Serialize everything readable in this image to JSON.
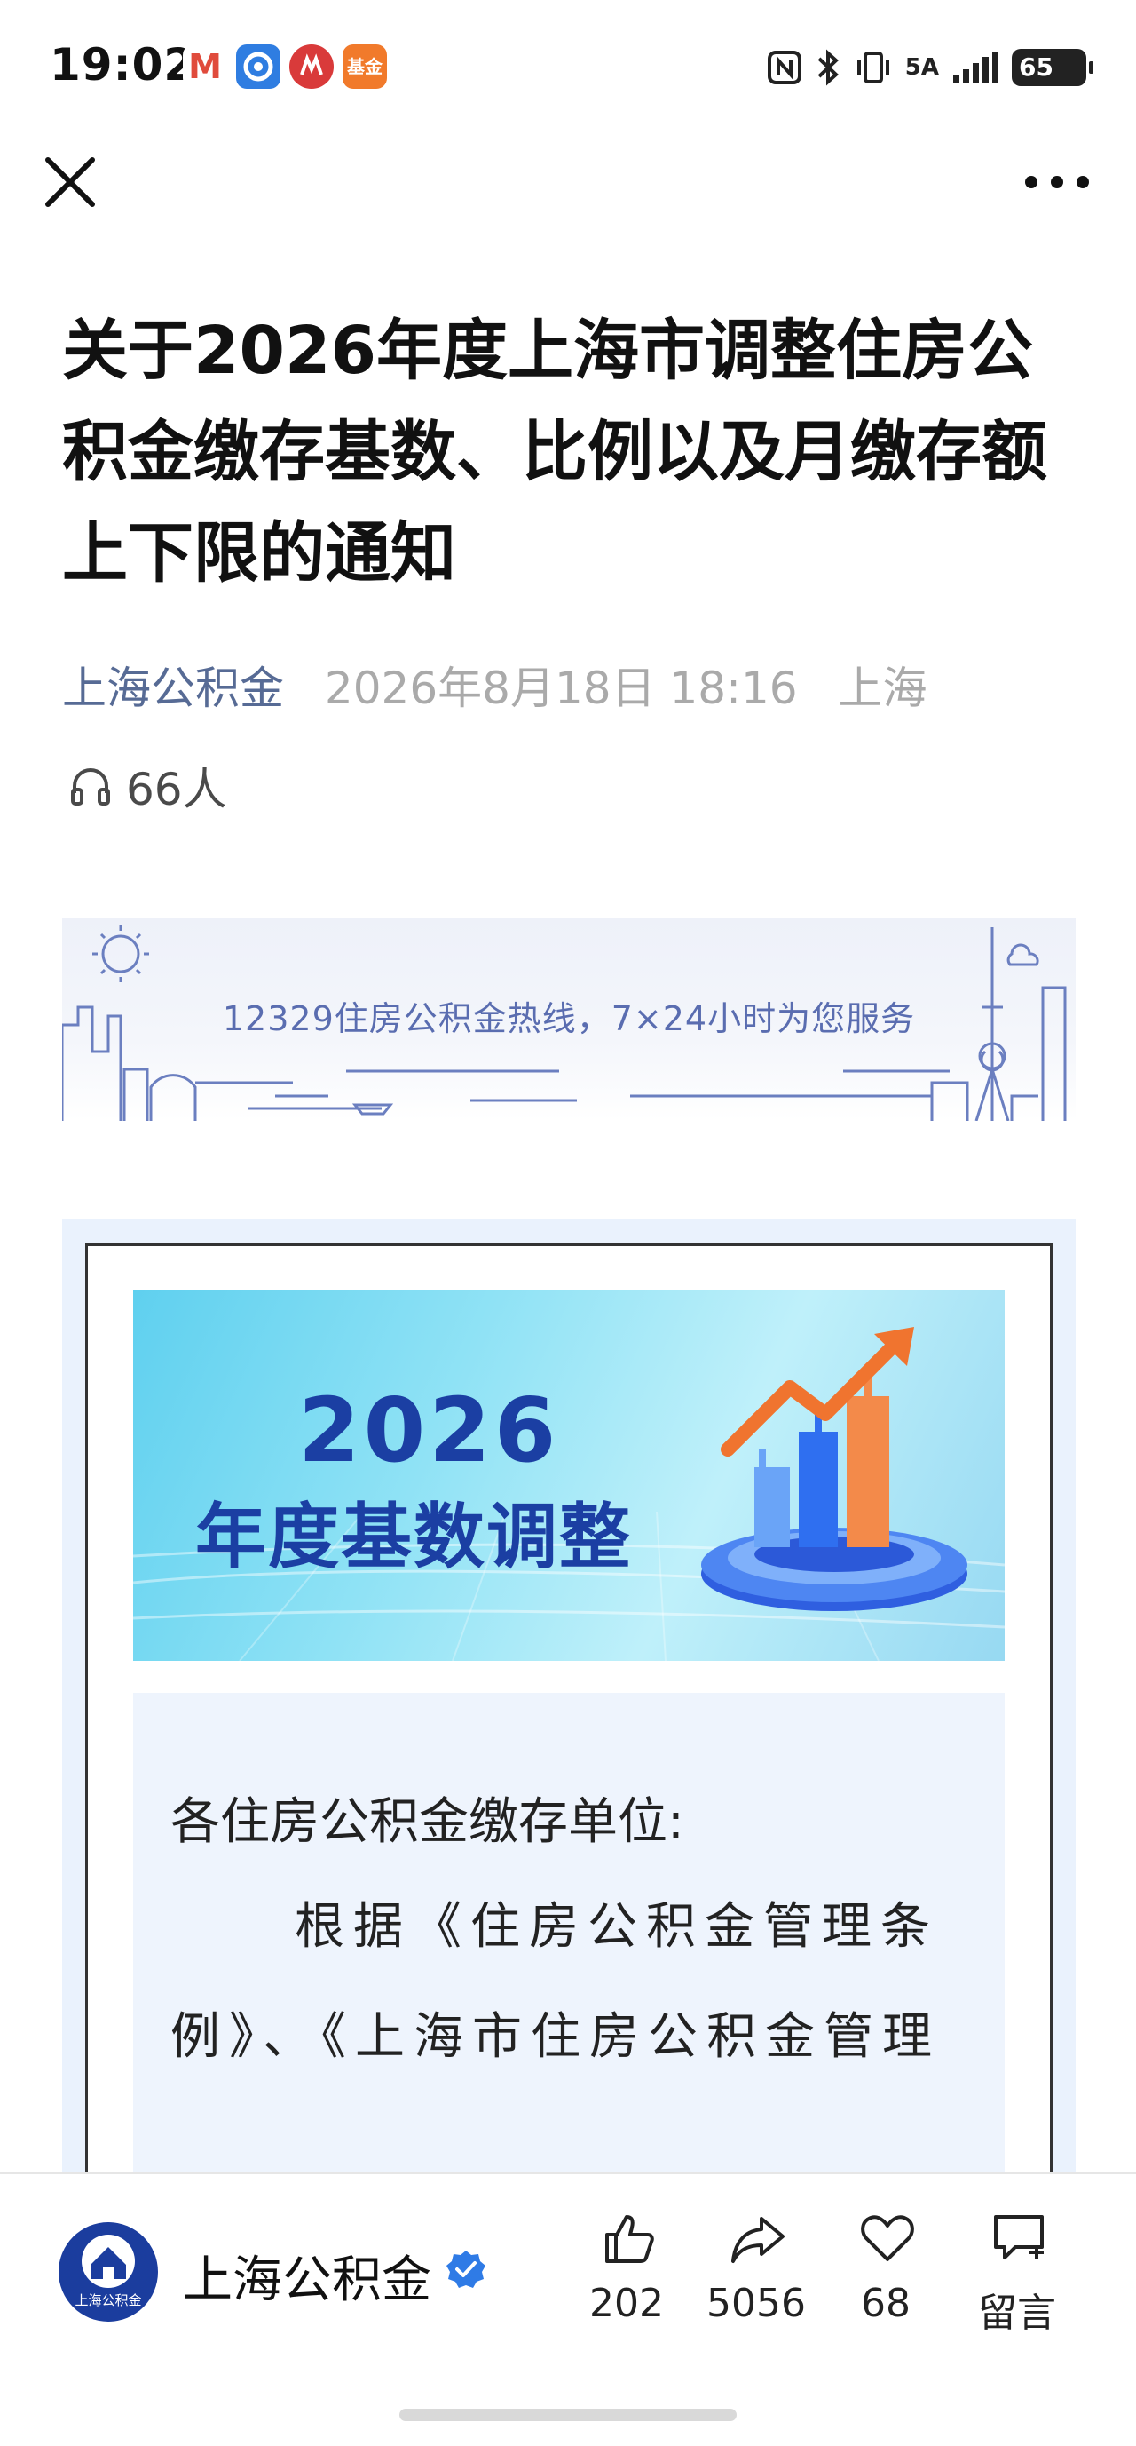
{
  "status_bar": {
    "time": "19:02",
    "apps": [
      {
        "icon": "gmail-icon",
        "label": "M",
        "color": "#e04b3c"
      },
      {
        "icon": "browser-icon",
        "label": "C",
        "color": "#2f7de1"
      },
      {
        "icon": "bank-icon",
        "label": "",
        "color": "#d93a3a"
      },
      {
        "icon": "fund-app-icon",
        "label": "基金",
        "color": "#f17a2b"
      }
    ],
    "network": "5A",
    "battery": "65"
  },
  "nav": {
    "close_icon": "close-icon",
    "more_icon": "more-dots-icon"
  },
  "article": {
    "title": "关于2026年度上海市调整住房公积金缴存基数、比例以及月缴存额上下限的通知",
    "author": "上海公积金",
    "date": "2026年8月18日 18:16",
    "location": "上海",
    "listeners": "66人"
  },
  "hotline_banner": {
    "text": "12329住房公积金热线，7×24小时为您服务"
  },
  "promo": {
    "year": "2026",
    "subtitle": "年度基数调整"
  },
  "letter": {
    "salutation": "各住房公积金缴存单位:",
    "body": "根据《住房公积金管理条例》、《上海市住房公积金管理"
  },
  "bottom_bar": {
    "account_name": "上海公积金",
    "avatar_text": "上海公积金",
    "actions": {
      "like": "202",
      "share": "5056",
      "favorite": "68",
      "comment": "留言"
    }
  },
  "colors": {
    "author_link": "#576b95",
    "promo_text": "#1b3fa3",
    "verified_badge": "#2f7be6"
  }
}
